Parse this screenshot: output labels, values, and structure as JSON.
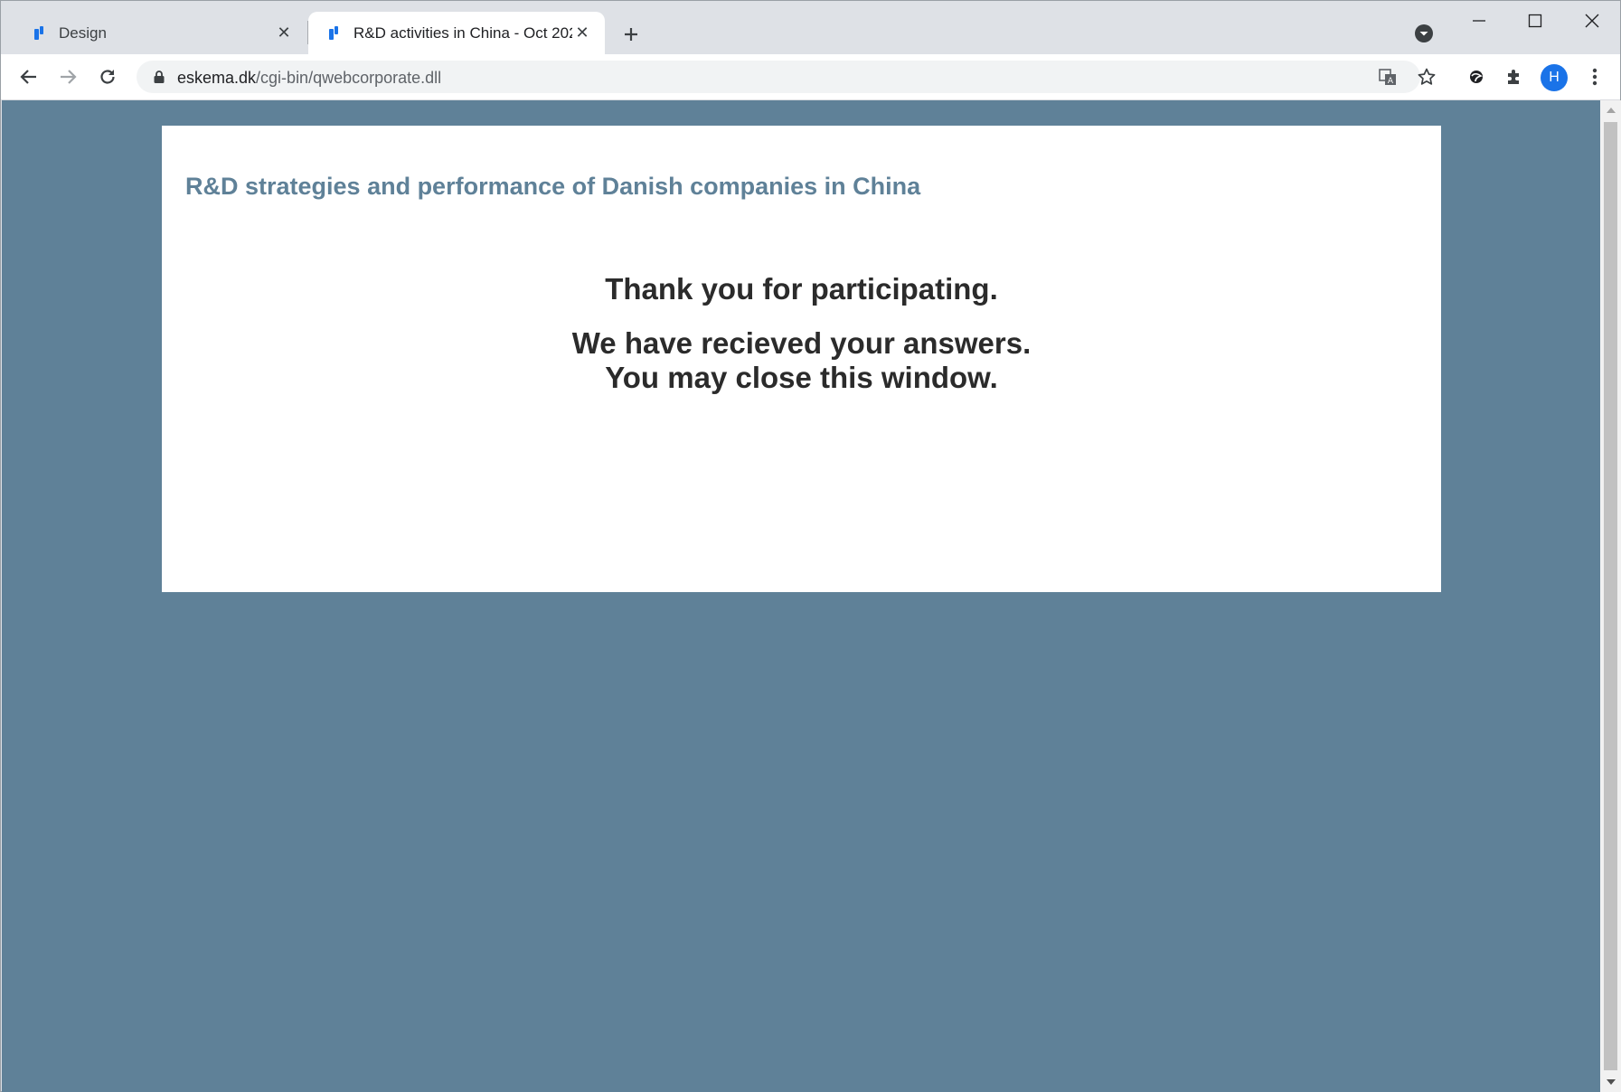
{
  "browser": {
    "tabs": [
      {
        "title": "Design",
        "active": false,
        "favicon": "questback-favicon-icon"
      },
      {
        "title": "R&D activities in China - Oct 202",
        "active": true,
        "favicon": "questback-favicon-icon"
      }
    ],
    "address": {
      "domain": "eskema.dk",
      "path": "/cgi-bin/qwebcorporate.dll"
    },
    "profile_initial": "H",
    "colors": {
      "accent": "#1a73e8",
      "favicon": "#1a73e8"
    }
  },
  "page": {
    "survey_title": "R&D strategies and performance of Danish companies in China",
    "message_line1": "Thank you for participating.",
    "message_line2": "We have recieved your answers.",
    "message_line3": "You may close this window.",
    "colors": {
      "background": "#5f8198",
      "card": "#ffffff",
      "title": "#5f8198",
      "text": "#2b2b2b"
    }
  }
}
